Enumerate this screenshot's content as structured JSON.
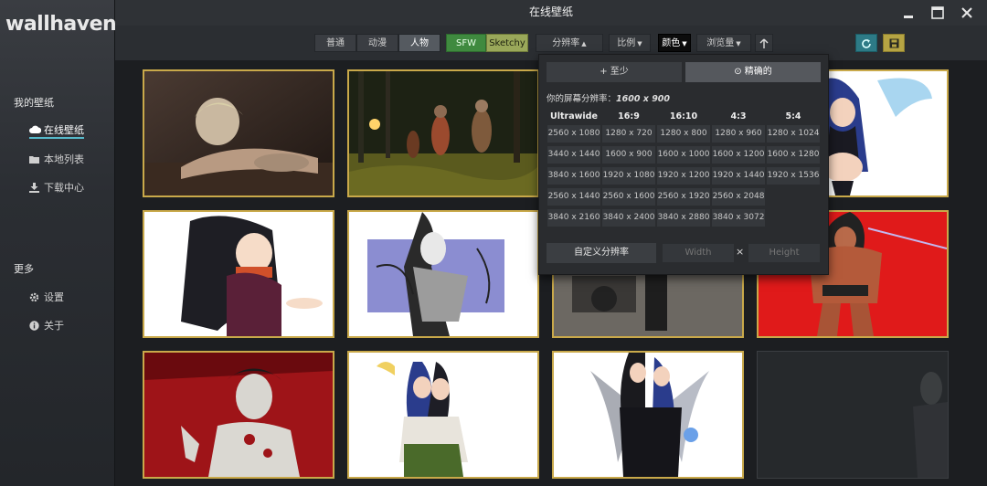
{
  "app": {
    "logo": "wallhaven",
    "window_title": "在线壁纸",
    "window_controls": [
      "minimize-icon",
      "maximize-icon",
      "close-icon"
    ]
  },
  "sidebar": {
    "section1_title": "我的壁纸",
    "items": [
      {
        "label": "在线壁纸",
        "icon": "cloud-icon",
        "active": true
      },
      {
        "label": "本地列表",
        "icon": "folder-icon"
      },
      {
        "label": "下载中心",
        "icon": "download-icon"
      }
    ],
    "section2_title": "更多",
    "more_items": [
      {
        "label": "设置",
        "icon": "gear-icon"
      },
      {
        "label": "关于",
        "icon": "info-icon"
      }
    ]
  },
  "toolbar": {
    "categories": [
      "普通",
      "动漫",
      "人物"
    ],
    "selected_category": "人物",
    "purity": [
      "SFW",
      "Sketchy"
    ],
    "resolution_label": "分辨率",
    "ratio_label": "比例",
    "color_label": "颜色",
    "sort_label": "浏览量",
    "sort_dir_icon": "arrow-up-icon",
    "refresh_icon": "refresh-icon",
    "save_icon": "save-icon"
  },
  "resolution_panel": {
    "mode_atleast": "+ 至少",
    "mode_exact": "⊙ 精确的",
    "active_mode": "exact",
    "screen_res_prefix": "你的屏幕分辨率：",
    "screen_res_value": "1600 x 900",
    "columns": [
      {
        "header": "Ultrawide",
        "values": [
          "2560 x 1080",
          "3440 x 1440",
          "3840 x 1600",
          "2560 x 1440",
          "3840 x 2160"
        ]
      },
      {
        "header": "16:9",
        "values": [
          "1280 x 720",
          "1600 x 900",
          "1920 x 1080",
          "2560 x 1600",
          "3840 x 2400"
        ]
      },
      {
        "header": "16:10",
        "values": [
          "1280 x 800",
          "1600 x 1000",
          "1920 x 1200",
          "2560 x 1920",
          "3840 x 2880"
        ]
      },
      {
        "header": "4:3",
        "values": [
          "1280 x 960",
          "1600 x 1200",
          "1920 x 1440",
          "2560 x 2048",
          "3840 x 3072"
        ]
      },
      {
        "header": "5:4",
        "values": [
          "1280 x 1024",
          "1600 x 1280",
          "1920 x 1536"
        ]
      }
    ],
    "custom_label": "自定义分辨率",
    "width_placeholder": "Width",
    "height_placeholder": "Height",
    "times_symbol": "×"
  },
  "wallpapers": [
    {
      "subject": "woman-lying-dim-room"
    },
    {
      "subject": "zombies-forest-shooting"
    },
    {
      "subject": "hidden-under-panel"
    },
    {
      "subject": "anime-angel-wings-pair"
    },
    {
      "subject": "anime-girl-black-hair-dress"
    },
    {
      "subject": "tattooed-woman-sketch"
    },
    {
      "subject": "figure-by-car-partially-hidden"
    },
    {
      "subject": "muscular-figure-red-background"
    },
    {
      "subject": "vampire-red-background"
    },
    {
      "subject": "anime-pair-blue-hair"
    },
    {
      "subject": "anime-pair-wings-black-outfit"
    },
    {
      "subject": "empty-dark-tile"
    }
  ]
}
